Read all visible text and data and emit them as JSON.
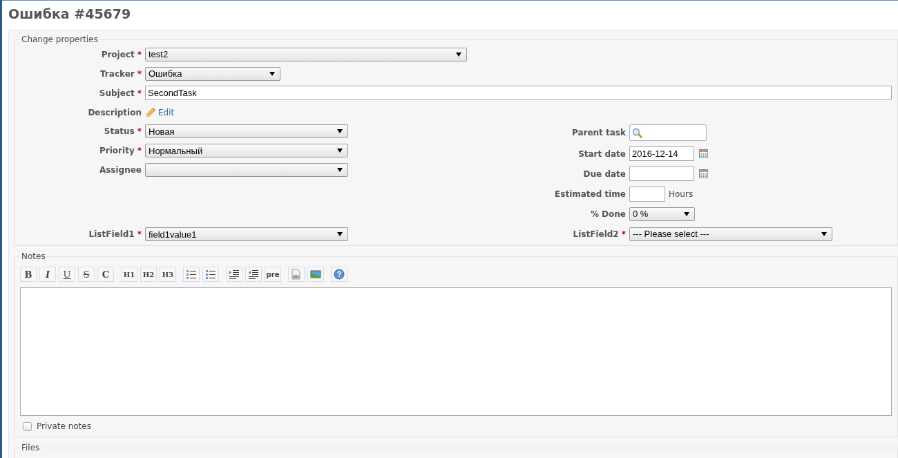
{
  "page_title": "Ошибка #45679",
  "properties": {
    "legend": "Change properties",
    "top_fields": [
      {
        "kind": "select",
        "label": "Project",
        "required_mark": "*",
        "value": "test2"
      },
      {
        "kind": "select",
        "label": "Tracker",
        "required_mark": "*",
        "value": "Ошибка"
      },
      {
        "kind": "text",
        "label": "Subject",
        "required_mark": "*",
        "value": "SecondTask"
      },
      {
        "kind": "edit-link",
        "label": "Description",
        "value": "Edit"
      }
    ],
    "left_fields": [
      {
        "kind": "select",
        "label": "Status",
        "required_mark": "*",
        "value": "Новая"
      },
      {
        "kind": "select",
        "label": "Priority",
        "required_mark": "*",
        "value": "Нормальный"
      },
      {
        "kind": "select",
        "label": "Assignee"
      }
    ],
    "left_bottom_field": {
      "kind": "select",
      "label": "ListField1",
      "required_mark": "*",
      "value": "field1value1"
    },
    "right_fields": [
      {
        "kind": "search",
        "label": "Parent task"
      },
      {
        "kind": "date",
        "label": "Start date",
        "value": "2016-12-14"
      },
      {
        "kind": "date",
        "label": "Due date"
      },
      {
        "kind": "hours",
        "label": "Estimated time",
        "suffix": "Hours"
      },
      {
        "kind": "select",
        "label": "% Done",
        "value": "0 %"
      },
      {
        "kind": "select",
        "label": "ListField2",
        "required_mark": "*",
        "value": "--- Please select ---"
      }
    ]
  },
  "notes": {
    "legend": "Notes",
    "toolbar": [
      [
        {
          "kind": "text",
          "label": "B"
        },
        {
          "kind": "text",
          "label": "I"
        },
        {
          "kind": "text",
          "label": "U"
        },
        {
          "kind": "text",
          "label": "S"
        },
        {
          "kind": "text",
          "label": "C"
        }
      ],
      [
        {
          "kind": "text",
          "label": "H1"
        },
        {
          "kind": "text",
          "label": "H2"
        },
        {
          "kind": "text",
          "label": "H3"
        }
      ],
      [
        {
          "kind": "icon"
        },
        {
          "kind": "icon"
        }
      ],
      [
        {
          "kind": "icon"
        },
        {
          "kind": "icon"
        },
        {
          "kind": "text",
          "label": "pre"
        }
      ],
      [
        {
          "kind": "icon"
        },
        {
          "kind": "icon"
        }
      ],
      [
        {
          "kind": "icon"
        }
      ]
    ],
    "private": {
      "label": "Private notes",
      "checked": false
    }
  },
  "files": {
    "legend": "Files"
  }
}
